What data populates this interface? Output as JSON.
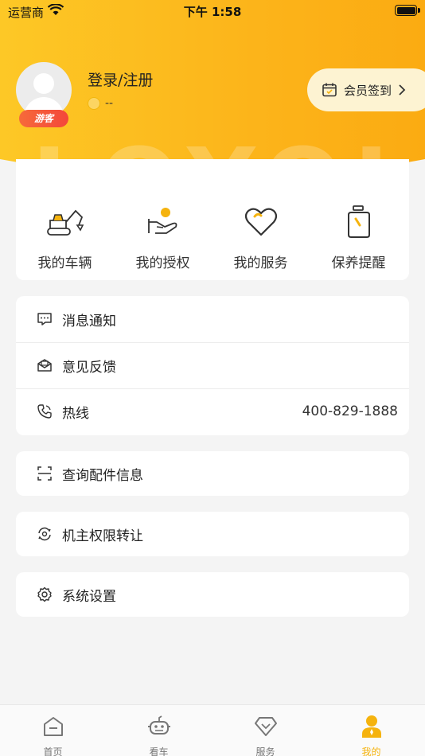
{
  "status_bar": {
    "carrier": "运营商",
    "time": "下午 1:58"
  },
  "profile": {
    "login_text": "登录/注册",
    "badge": "游客",
    "points": "--",
    "watermark": "LOYOL"
  },
  "checkin": {
    "label": "会员签到"
  },
  "quick_actions": [
    {
      "label": "我的车辆",
      "icon": "excavator-icon"
    },
    {
      "label": "我的授权",
      "icon": "hand-coin-icon"
    },
    {
      "label": "我的服务",
      "icon": "heart-icon"
    },
    {
      "label": "保养提醒",
      "icon": "oil-bottle-icon"
    }
  ],
  "menu_group_1": {
    "messages": "消息通知",
    "feedback": "意见反馈",
    "hotline": "热线",
    "hotline_number": "400-829-1888"
  },
  "menu_parts": "查询配件信息",
  "menu_transfer": "机主权限转让",
  "menu_settings": "系统设置",
  "tabs": [
    {
      "label": "首页",
      "icon": "home-icon",
      "active": false
    },
    {
      "label": "看车",
      "icon": "robot-icon",
      "active": false
    },
    {
      "label": "服务",
      "icon": "diamond-icon",
      "active": false
    },
    {
      "label": "我的",
      "icon": "user-icon",
      "active": true
    }
  ],
  "colors": {
    "accent": "#fcb41a",
    "active_tab": "#f5b30e",
    "badge": "#f4473a"
  }
}
